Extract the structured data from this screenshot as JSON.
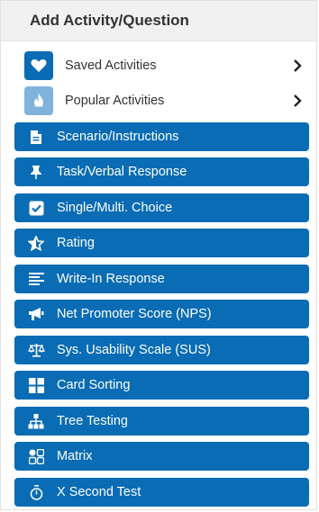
{
  "header": {
    "title": "Add Activity/Question"
  },
  "library": [
    {
      "label": "Saved Activities",
      "icon": "heart-icon",
      "icon_bg": "#0a6cb4"
    },
    {
      "label": "Popular Activities",
      "icon": "flame-icon",
      "icon_bg": "#7fb3dc"
    }
  ],
  "activities": [
    {
      "label": "Scenario/Instructions",
      "icon": "document-icon"
    },
    {
      "label": "Task/Verbal Response",
      "icon": "pin-icon"
    },
    {
      "label": "Single/Multi. Choice",
      "icon": "checkbox-icon"
    },
    {
      "label": "Rating",
      "icon": "star-icon"
    },
    {
      "label": "Write-In Response",
      "icon": "lines-icon"
    },
    {
      "label": "Net Promoter Score (NPS)",
      "icon": "megaphone-icon"
    },
    {
      "label": "Sys. Usability Scale (SUS)",
      "icon": "scale-icon"
    },
    {
      "label": "Card Sorting",
      "icon": "grid-icon"
    },
    {
      "label": "Tree Testing",
      "icon": "sitemap-icon"
    },
    {
      "label": "Matrix",
      "icon": "matrix-icon"
    },
    {
      "label": "X Second Test",
      "icon": "stopwatch-icon"
    }
  ],
  "colors": {
    "accent": "#0a6cb4",
    "accent_light": "#7fb3dc",
    "header_bg": "#f1f1f1"
  }
}
